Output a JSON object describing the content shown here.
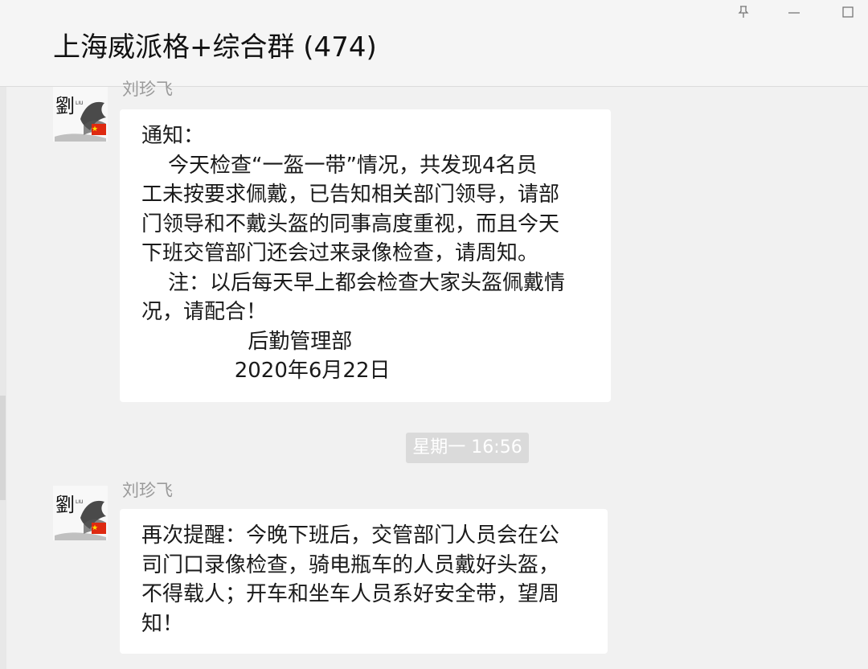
{
  "window": {
    "title": "上海威派格+综合群 (474)"
  },
  "messages": [
    {
      "sender": "刘珍飞",
      "lines": [
        "通知：",
        "    今天检查“一盔一带”情况，共发现4名员",
        "工未按要求佩戴，已告知相关部门领导，请部",
        "门领导和不戴头盔的同事高度重视，而且今天",
        "下班交管部门还会过来录像检查，请周知。",
        "    注：以后每天早上都会检查大家头盔佩戴情",
        "况，请配合！",
        "                后勤管理部",
        "              2020年6月22日"
      ]
    },
    {
      "sender": "刘珍飞",
      "lines": [
        "再次提醒：今晚下班后，交管部门人员会在公",
        "司门口录像检查，骑电瓶车的人员戴好头盔，",
        "不得载人；开车和坐车人员系好安全带，望周",
        "知！"
      ]
    }
  ],
  "timestamp": "星期一 16:56",
  "avatar": {
    "calligraphy": "劉",
    "small_text": "LIU"
  },
  "colors": {
    "background": "#f1f1f1",
    "bubble": "#ffffff",
    "sender": "#9a9a9a",
    "timestamp_bg": "#dadada",
    "flag_red": "#de2910",
    "flag_star": "#ffde00"
  },
  "icons": {
    "pin": "pin-icon",
    "minimize": "minimize-icon",
    "maximize": "maximize-icon",
    "flag": "china-flag-icon"
  }
}
